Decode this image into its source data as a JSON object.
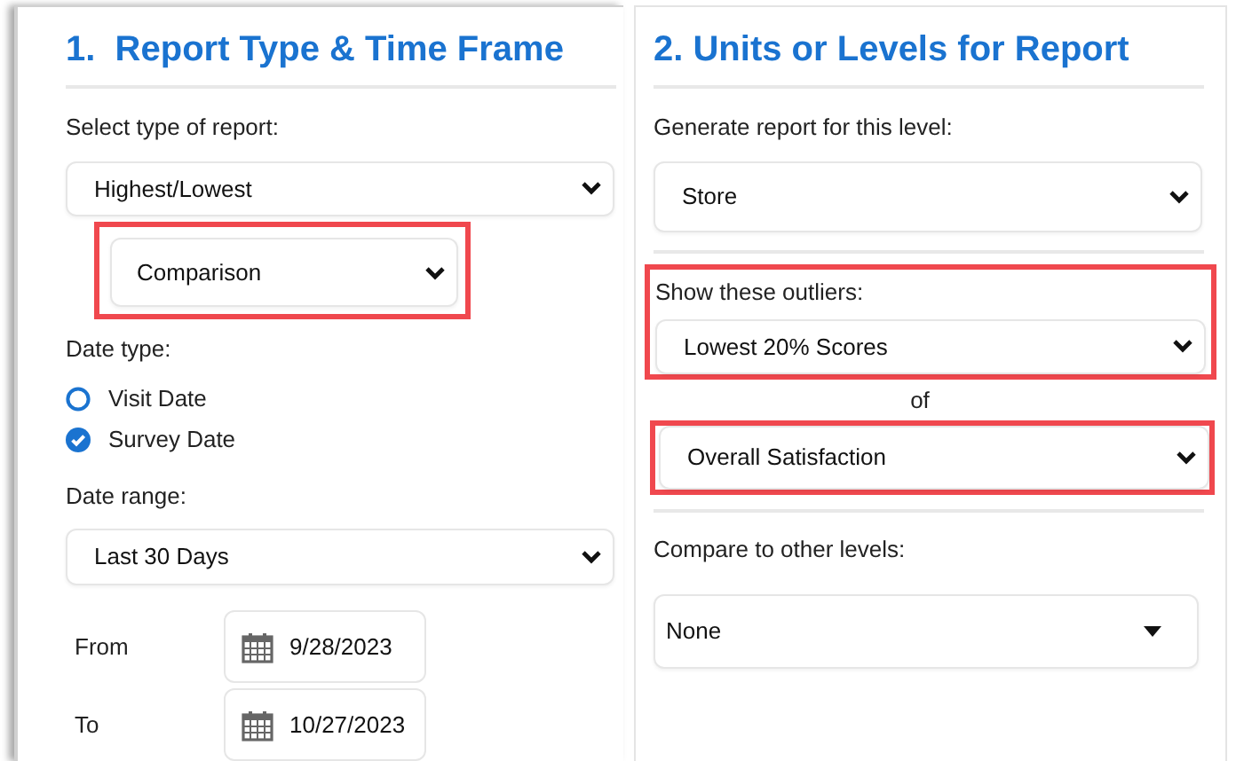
{
  "left": {
    "title": "1.  Report Type & Time Frame",
    "report_type": {
      "label": "Select type of report:",
      "value": "Highest/Lowest"
    },
    "sub_type": {
      "value": "Comparison",
      "highlighted": true
    },
    "date_type": {
      "label": "Date type:",
      "options": [
        {
          "label": "Visit Date",
          "selected": false
        },
        {
          "label": "Survey Date",
          "selected": true
        }
      ]
    },
    "date_range": {
      "label": "Date range:",
      "value": "Last 30 Days"
    },
    "dates": [
      {
        "label": "From",
        "value": "9/28/2023"
      },
      {
        "label": "To",
        "value": "10/27/2023"
      }
    ]
  },
  "right": {
    "title": "2. Units or Levels for Report",
    "level": {
      "label": "Generate report for this level:",
      "value": "Store"
    },
    "outliers": {
      "label": "Show these outliers:",
      "value": "Lowest 20% Scores",
      "highlighted": true
    },
    "connector": "of",
    "measure": {
      "value": "Overall Satisfaction",
      "highlighted": true
    },
    "compare": {
      "label": "Compare to other levels:",
      "value": "None",
      "kind": "caret"
    }
  }
}
